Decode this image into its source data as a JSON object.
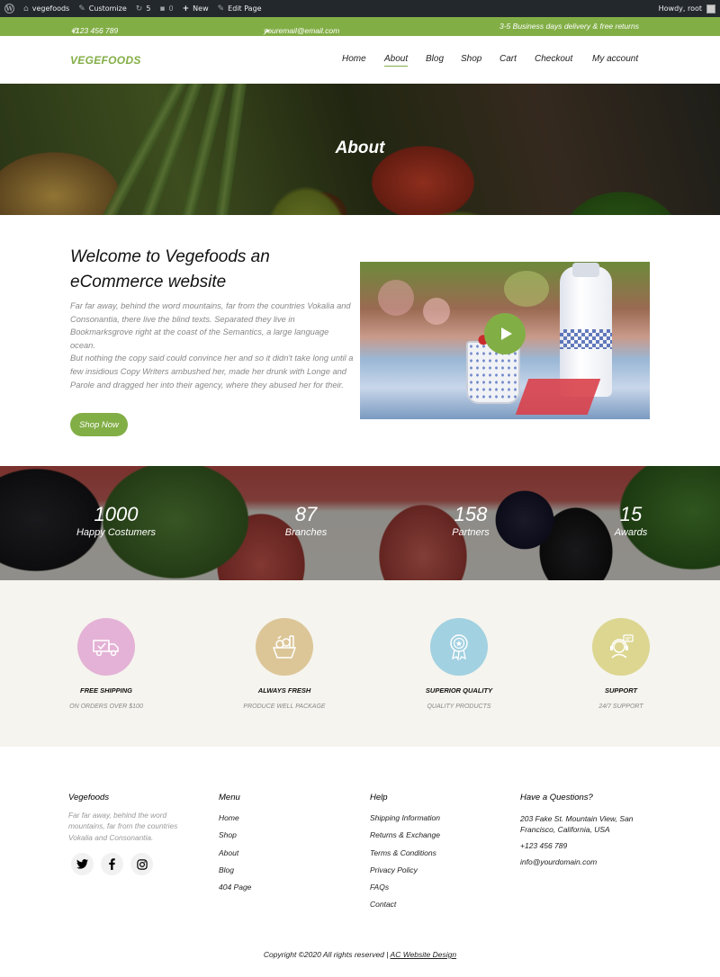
{
  "adminbar": {
    "site_name": "vegefoods",
    "customize": "Customize",
    "updates": "5",
    "comments": "0",
    "new": "New",
    "edit_page": "Edit Page",
    "howdy": "Howdy, root"
  },
  "topbar": {
    "phone": "+123 456 789",
    "email": "youremail@email.com",
    "delivery": "3-5 Business days delivery & free returns"
  },
  "header": {
    "logo": "VEGEFOODS",
    "nav": [
      "Home",
      "About",
      "Blog",
      "Shop",
      "Cart",
      "Checkout",
      "My account"
    ],
    "active_nav": "About"
  },
  "hero": {
    "title": "About"
  },
  "about": {
    "title": "Welcome to Vegefoods an eCommerce website",
    "paragraph1": "Far far away, behind the word mountains, far from the countries Vokalia and Consonantia, there live the blind texts. Separated they live in Bookmarksgrove right at the coast of the Semantics, a large language ocean.",
    "paragraph2": "But nothing the copy said could convince her and so it didn't take long until a few insidious Copy Writers ambushed her, made her drunk with Longe and Parole and dragged her into their agency, where they abused her for their.",
    "button": "Shop Now"
  },
  "counters": [
    {
      "number": "1000",
      "label": "Happy Costumers"
    },
    {
      "number": "87",
      "label": "Branches"
    },
    {
      "number": "158",
      "label": "Partners"
    },
    {
      "number": "15",
      "label": "Awards"
    }
  ],
  "services": [
    {
      "title": "FREE SHIPPING",
      "subtitle": "ON ORDERS OVER $100",
      "color": "#e4b2d6",
      "icon": "truck-icon"
    },
    {
      "title": "ALWAYS FRESH",
      "subtitle": "PRODUCE WELL PACKAGE",
      "color": "#dcc698",
      "icon": "produce-icon"
    },
    {
      "title": "SUPERIOR QUALITY",
      "subtitle": "QUALITY PRODUCTS",
      "color": "#a2d1e1",
      "icon": "award-icon"
    },
    {
      "title": "SUPPORT",
      "subtitle": "24/7 SUPPORT",
      "color": "#dcd691",
      "icon": "support-icon"
    }
  ],
  "footer": {
    "brand_title": "Vegefoods",
    "brand_desc": "Far far away, behind the word mountains, far from the countries Vokalia and Consonantia.",
    "menu_title": "Menu",
    "menu": [
      "Home",
      "Shop",
      "About",
      "Blog",
      "404 Page"
    ],
    "help_title": "Help",
    "help": [
      "Shipping Information",
      "Returns & Exchange",
      "Terms & Conditions",
      "Privacy Policy",
      "FAQs",
      "Contact"
    ],
    "contact_title": "Have a Questions?",
    "address": "203 Fake St. Mountain View, San Francisco, California, USA",
    "phone": "+123 456 789",
    "email": "info@yourdomain.com",
    "copyright": "Copyright ©2020 All rights reserved |",
    "copyright_link": "AC Website Design"
  },
  "colors": {
    "brand_green": "#82ae46",
    "admin_bar": "#23282d",
    "services_bg": "#f5f4ee"
  }
}
